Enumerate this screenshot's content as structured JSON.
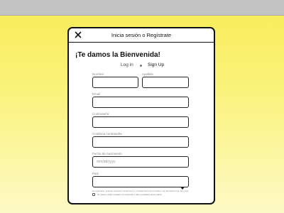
{
  "window": {
    "title": "Inicia sesión o Regístrate"
  },
  "modal": {
    "close_icon": "close-icon",
    "welcome": "¡Te damos la Bienvenida!",
    "tabs": {
      "login": "Log in",
      "signup": "Sign Up"
    }
  },
  "form": {
    "nombre": {
      "label": "Nombre",
      "value": ""
    },
    "apellido": {
      "label": "Apellido",
      "value": ""
    },
    "email": {
      "label": "Email",
      "value": ""
    },
    "password": {
      "label": "Contraseña",
      "value": ""
    },
    "confirm_password": {
      "label": "Confirma contraseña",
      "value": ""
    },
    "birthdate": {
      "label": "Fecha de nacimiento",
      "placeholder": "mm/dd/yyyy"
    },
    "country": {
      "label": "País",
      "value": ""
    },
    "terms_text": "Al registrarte, aceptas nuestras condiciones y el tratamiento de tus datos y la información de las cookies.",
    "newsletter_text": "Sí, quiero recibir noticias, promociones y las novedades de la marca."
  },
  "colors": {
    "background_top": "#f7ec55",
    "background_bottom": "#fdf9c6",
    "topbar": "#c3c3c3",
    "border": "#111111"
  }
}
